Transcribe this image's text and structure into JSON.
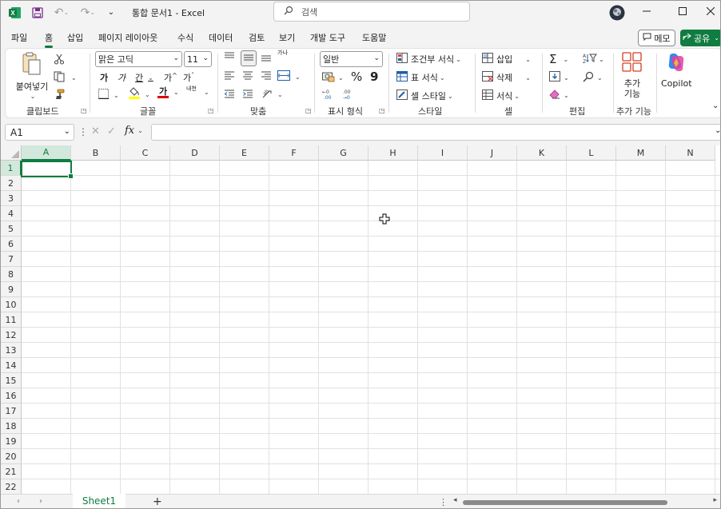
{
  "titlebar": {
    "doc_title": "통합 문서1  -  Excel",
    "search_placeholder": "검색"
  },
  "menu": {
    "tabs": [
      {
        "label": "파일"
      },
      {
        "label": "홈",
        "active": true
      },
      {
        "label": "삽입"
      },
      {
        "label": "페이지 레이아웃"
      },
      {
        "label": "수식"
      },
      {
        "label": "데이터"
      },
      {
        "label": "검토"
      },
      {
        "label": "보기"
      },
      {
        "label": "개발 도구"
      },
      {
        "label": "도움말"
      }
    ],
    "memo_label": "메모",
    "share_label": "공유"
  },
  "ribbon": {
    "clipboard": {
      "paste_label": "붙여넣기",
      "group_label": "클립보드"
    },
    "font": {
      "font_name": "맑은 고딕",
      "font_size": "11",
      "group_label": "글꼴",
      "bold": "가",
      "italic": "가",
      "underline": "간",
      "grow": "가",
      "shrink": "가",
      "text_color": "가",
      "phonetic": "내천"
    },
    "alignment": {
      "group_label": "맞춤",
      "wrap_glyph": "가나"
    },
    "number": {
      "format": "일반",
      "group_label": "표시 형식",
      "percent": "%",
      "comma": "9"
    },
    "styles": {
      "conditional": "조건부 서식",
      "table_format": "표 서식",
      "cell_style": "셀 스타일",
      "group_label": "스타일"
    },
    "cells": {
      "insert": "삽입",
      "delete": "삭제",
      "format": "서식",
      "group_label": "셀"
    },
    "editing": {
      "group_label": "편집"
    },
    "addins": {
      "label_line1": "추가",
      "label_line2": "기능",
      "group_label": "추가 기능"
    },
    "copilot": {
      "label": "Copilot"
    }
  },
  "formula_bar": {
    "name_box": "A1",
    "fx": "fx"
  },
  "grid": {
    "columns": [
      "A",
      "B",
      "C",
      "D",
      "E",
      "F",
      "G",
      "H",
      "I",
      "J",
      "K",
      "L",
      "M",
      "N"
    ],
    "rows": [
      "1",
      "2",
      "3",
      "4",
      "5",
      "6",
      "7",
      "8",
      "9",
      "10",
      "11",
      "12",
      "13",
      "14",
      "15",
      "16",
      "17",
      "18",
      "19",
      "20",
      "21",
      "22"
    ],
    "selected_cell": "A1"
  },
  "sheets": {
    "tabs": [
      "Sheet1"
    ]
  },
  "colors": {
    "accent": "#107c41",
    "excel_green": "#107c41"
  }
}
